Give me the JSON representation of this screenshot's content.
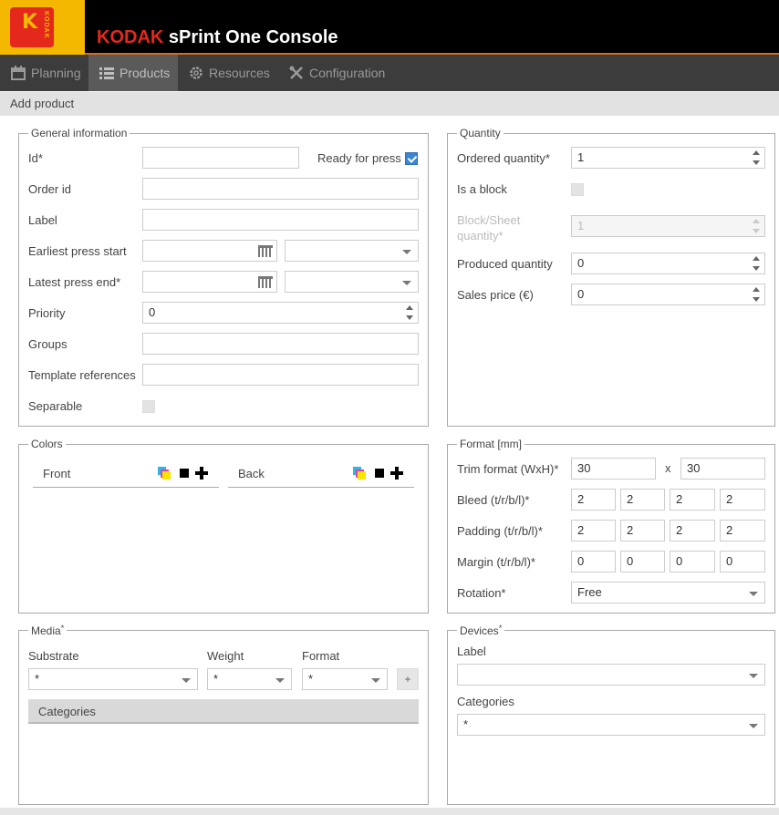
{
  "app": {
    "brand_name": "KODAK",
    "product_name": "sPrint One Console",
    "logo_text": "KODAK",
    "colors": {
      "brand_red": "#e4281c",
      "brand_yellow": "#f5b800",
      "header_bg": "#000000",
      "nav_bg": "#3c3c3c",
      "accent_blue": "#3a86d2"
    }
  },
  "nav": {
    "planning": "Planning",
    "products": "Products",
    "resources": "Resources",
    "configuration": "Configuration",
    "active": "Products"
  },
  "page": {
    "title": "Add product"
  },
  "general": {
    "legend": "General information",
    "id_label": "Id*",
    "id_value": "",
    "ready_label": "Ready for press",
    "ready_checked": true,
    "order_id_label": "Order id",
    "order_id_value": "",
    "label_label": "Label",
    "label_value": "",
    "earliest_label": "Earliest press start",
    "earliest_date": "",
    "earliest_time": "",
    "latest_label": "Latest press end*",
    "latest_date": "",
    "latest_time": "",
    "priority_label": "Priority",
    "priority_value": "0",
    "groups_label": "Groups",
    "groups_value": "",
    "template_label": "Template references",
    "template_value": "",
    "separable_label": "Separable",
    "separable_checked": false
  },
  "quantity": {
    "legend": "Quantity",
    "ordered_label": "Ordered quantity*",
    "ordered_value": "1",
    "block_label": "Is a block",
    "block_checked": false,
    "block_sheet_label_1": "Block/Sheet",
    "block_sheet_label_2": "quantity*",
    "block_sheet_value": "1",
    "produced_label": "Produced quantity",
    "produced_value": "0",
    "sales_label": "Sales price (€)",
    "sales_value": "0"
  },
  "colors_panel": {
    "legend": "Colors",
    "front_label": "Front",
    "back_label": "Back"
  },
  "format": {
    "legend": "Format [mm]",
    "trim_label": "Trim format (WxH)*",
    "trim_w": "30",
    "trim_x": "x",
    "trim_h": "30",
    "bleed_label": "Bleed (t/r/b/l)*",
    "bleed": [
      "2",
      "2",
      "2",
      "2"
    ],
    "padding_label": "Padding (t/r/b/l)*",
    "padding": [
      "2",
      "2",
      "2",
      "2"
    ],
    "margin_label": "Margin (t/r/b/l)*",
    "margin": [
      "0",
      "0",
      "0",
      "0"
    ],
    "rotation_label": "Rotation*",
    "rotation_value": "Free"
  },
  "media": {
    "legend": "Media",
    "legend_star": "*",
    "substrate_label": "Substrate",
    "substrate_value": "*",
    "weight_label": "Weight",
    "weight_value": "*",
    "format_label": "Format",
    "format_value": "*",
    "add_label": "+",
    "categories_label": "Categories"
  },
  "devices": {
    "legend": "Devices",
    "legend_star": "*",
    "label_label": "Label",
    "label_value": "",
    "categories_label": "Categories",
    "categories_value": "*"
  }
}
